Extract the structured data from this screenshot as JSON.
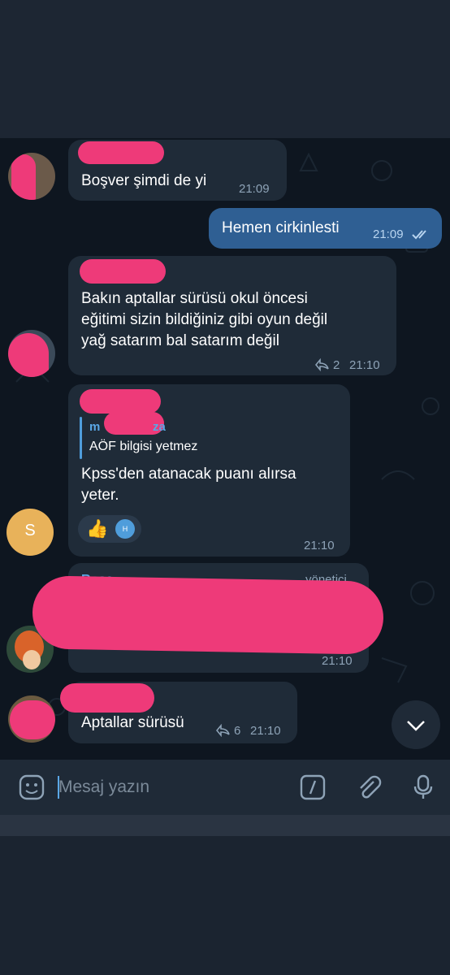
{
  "messages": [
    {
      "text": "Boşver şimdi de yi",
      "time": "21:09"
    },
    {
      "text": "Hemen cirkinlesti",
      "time": "21:09"
    },
    {
      "lines": [
        "Bakın aptallar sürüsü okul öncesi",
        "eğitimi sizin bildiğiniz gibi oyun değil",
        "yağ satarım bal satarım değil"
      ],
      "replies": "2",
      "time": "21:10"
    },
    {
      "reply_name": "m",
      "reply_name_tail": "za",
      "reply_text": "AÖF bilgisi yetmez",
      "lines": [
        "Kpss'den atanacak puanı alırsa",
        "yeter."
      ],
      "reaction_avatar_letter": "H",
      "time": "21:10",
      "avatar_letter": "S"
    },
    {
      "sender": "Rose",
      "role": "yönetici",
      "time": "21:10"
    },
    {
      "text": "Aptallar sürüsü",
      "replies": "6",
      "time": "21:10"
    }
  ],
  "input": {
    "placeholder": "Mesaj yazın"
  },
  "icons": [
    "sticker-icon",
    "command-icon",
    "attach-icon",
    "mic-icon",
    "scroll-down-icon",
    "read-check-icon",
    "reply-count-icon",
    "thumbs-up-icon"
  ],
  "colors": {
    "accent": "#5aa7e6",
    "outgoing_bubble": "#2f5f93",
    "incoming_bubble": "#1f2b38",
    "redaction": "#ee3a79"
  }
}
